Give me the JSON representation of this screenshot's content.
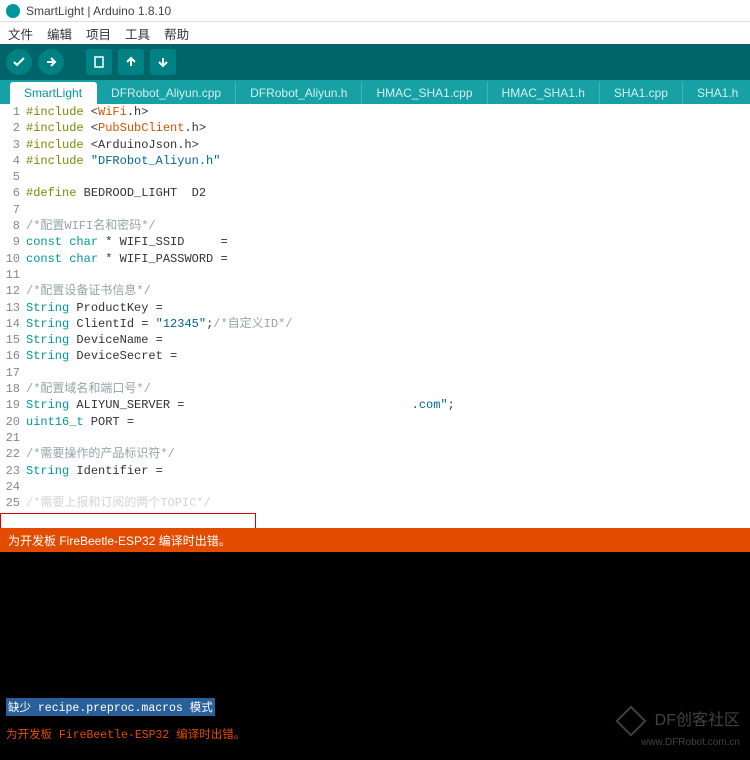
{
  "window": {
    "title": "SmartLight | Arduino 1.8.10"
  },
  "menu": {
    "file": "文件",
    "edit": "编辑",
    "sketch": "项目",
    "tools": "工具",
    "help": "帮助"
  },
  "toolbar_icons": {
    "verify": "✔",
    "upload": "➔",
    "new": "▭",
    "open": "⬆",
    "save": "⬇"
  },
  "tabs": [
    {
      "label": "SmartLight",
      "active": true
    },
    {
      "label": "DFRobot_Aliyun.cpp"
    },
    {
      "label": "DFRobot_Aliyun.h"
    },
    {
      "label": "HMAC_SHA1.cpp"
    },
    {
      "label": "HMAC_SHA1.h"
    },
    {
      "label": "SHA1.cpp"
    },
    {
      "label": "SHA1.h"
    }
  ],
  "code": {
    "l1a": "#include",
    "l1b": " <",
    "l1c": "WiFi",
    "l1d": ".h>",
    "l2a": "#include",
    "l2b": " <",
    "l2c": "PubSubClient",
    "l2d": ".h>",
    "l3a": "#include",
    "l3b": " <ArduinoJson.h>",
    "l4a": "#include",
    "l4b": " ",
    "l4c": "\"DFRobot_Aliyun.h\"",
    "l6a": "#define",
    "l6b": " BEDROOD_LIGHT  D2",
    "l8": "/*配置WIFI名和密码*/",
    "l9a": "const",
    "l9b": " ",
    "l9c": "char",
    "l9d": " * WIFI_SSID     = ",
    "l10a": "const",
    "l10b": " ",
    "l10c": "char",
    "l10d": " * WIFI_PASSWORD = ",
    "l12": "/*配置设备证书信息*/",
    "l13a": "String",
    "l13b": " ProductKey = ",
    "l14a": "String",
    "l14b": " ClientId = ",
    "l14c": "\"12345\"",
    "l14d": ";",
    "l14e": "/*自定义ID*/",
    "l15a": "String",
    "l15b": " DeviceName = ",
    "l16a": "String",
    "l16b": " DeviceSecret = ",
    "l18": "/*配置域名和端口号*/",
    "l19a": "String",
    "l19b": " ALIYUN_SERVER = ",
    "l19c": ".com\"",
    "l19d": ";",
    "l20a": "uint16_t",
    "l20b": " PORT = ",
    "l22": "/*需要操作的产品标识符*/",
    "l23a": "String",
    "l23b": " Identifier = ",
    "l25": "/*需要上报和订阅的两个TOPIC*/"
  },
  "status": "为开发板 FireBeetle-ESP32 编译时出错。",
  "console": {
    "missing_pre": "缺少 ",
    "missing_code": "recipe.preproc.macros",
    "missing_post": " 模式",
    "err_line": "为开发板 FireBeetle-ESP32 编译时出错。"
  },
  "watermark": {
    "brand": "DF创客社区",
    "url": "www.DFRobot.com.cn"
  }
}
